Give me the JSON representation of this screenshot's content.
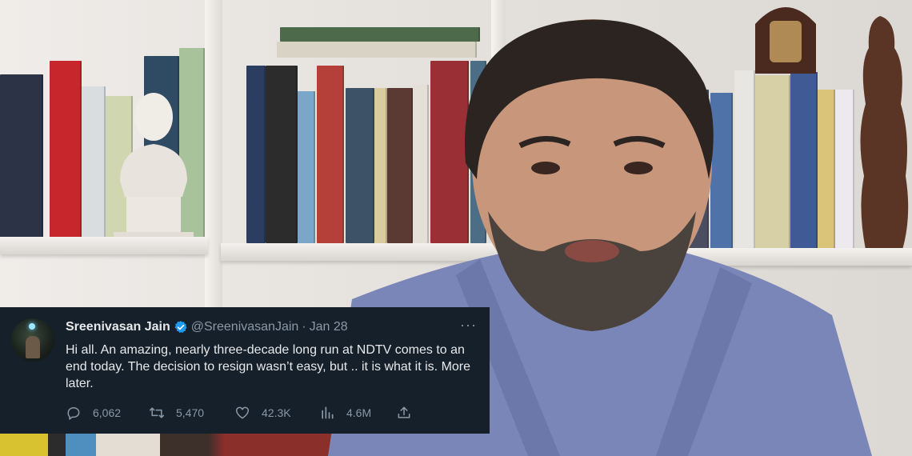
{
  "tweet": {
    "author_name": "Sreenivasan Jain",
    "handle": "@SreenivasanJain",
    "separator": "·",
    "date": "Jan 28",
    "more_label": "···",
    "text": "Hi all. An amazing, nearly three-decade long run at NDTV comes to an end today. The decision to resign wasn’t easy, but .. it is what it is. More later.",
    "stats": {
      "replies": "6,062",
      "retweets": "5,470",
      "likes": "42.3K",
      "views": "4.6M"
    },
    "icons": {
      "verified": "verified-badge-icon",
      "reply": "reply-icon",
      "retweet": "retweet-icon",
      "like": "heart-icon",
      "views": "views-icon",
      "share": "share-icon"
    },
    "colors": {
      "card_bg": "#15202b",
      "text": "#e7e9ea",
      "muted": "#8b98a5",
      "verified": "#1d9bf0"
    }
  }
}
